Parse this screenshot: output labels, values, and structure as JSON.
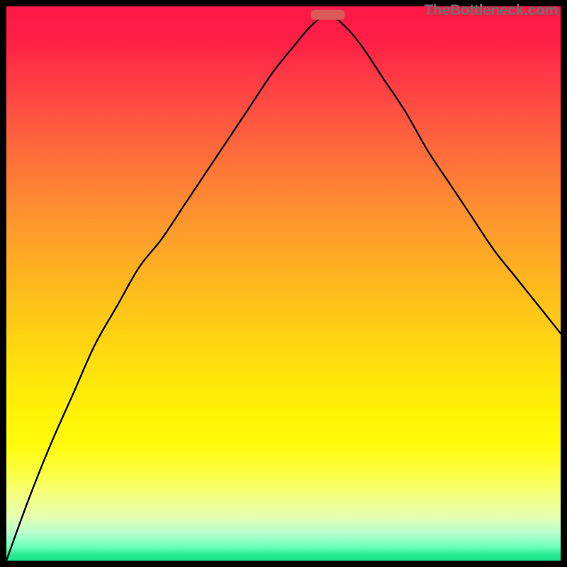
{
  "watermark": "TheBottleneck.com",
  "chart_data": {
    "type": "line",
    "title": "",
    "xlabel": "",
    "ylabel": "",
    "xlim": [
      0,
      100
    ],
    "ylim": [
      0,
      100
    ],
    "grid": false,
    "legend": false,
    "annotations": [],
    "marker": {
      "x": 58,
      "y": 98.5,
      "shape": "rounded-rect",
      "color": "#da5a59"
    },
    "series": [
      {
        "name": "bottleneck-curve",
        "x": [
          0,
          4,
          8,
          12,
          16,
          20,
          24,
          28,
          32,
          36,
          40,
          44,
          48,
          52,
          55,
          58,
          61,
          64,
          68,
          72,
          76,
          80,
          84,
          88,
          92,
          96,
          100
        ],
        "y": [
          0,
          11,
          21,
          30,
          39,
          46,
          53,
          58,
          64,
          70,
          76,
          82,
          88,
          93,
          96.5,
          98.5,
          96.5,
          93,
          87,
          81,
          74,
          68,
          62,
          56,
          51,
          46,
          41
        ]
      }
    ],
    "gradient_stops": [
      {
        "pos": 0,
        "color": "#ff1847"
      },
      {
        "pos": 50,
        "color": "#ffce14"
      },
      {
        "pos": 85,
        "color": "#fcff3f"
      },
      {
        "pos": 100,
        "color": "#1fe38a"
      }
    ]
  }
}
